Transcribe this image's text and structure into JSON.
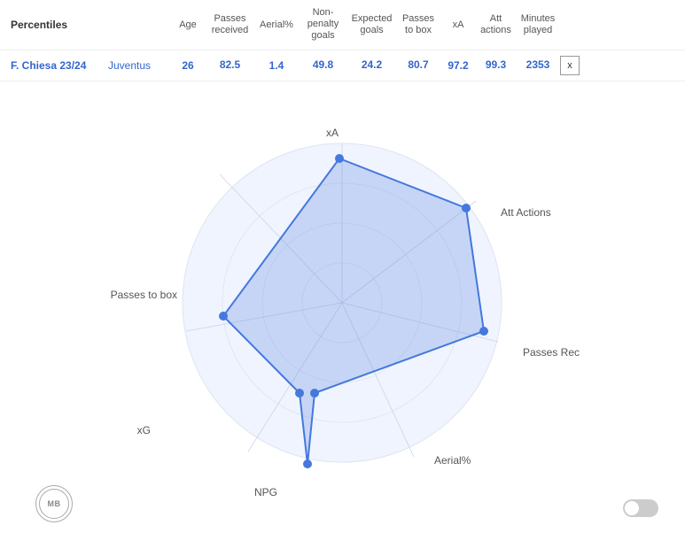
{
  "header": {
    "percentiles_label": "Percentiles",
    "columns": {
      "age": "Age",
      "passes_received": "Passes received",
      "aerial": "Aerial%",
      "npg": "Non-penalty goals",
      "xg": "Expected goals",
      "passes_box": "Passes to box",
      "xa": "xA",
      "att_actions": "Att actions",
      "minutes": "Minutes played"
    }
  },
  "player": {
    "name": "F. Chiesa 23/24",
    "team": "Juventus",
    "age": "26",
    "passes_received": "82.5",
    "aerial": "1.4",
    "npg": "49.8",
    "xg": "24.2",
    "passes_box": "80.7",
    "xa": "97.2",
    "att_actions": "99.3",
    "minutes": "2353",
    "close": "x"
  },
  "radar": {
    "labels": {
      "xa": "xA",
      "att_actions": "Att Actions",
      "passes_rec": "Passes Rec",
      "aerial": "Aerial%",
      "npg": "NPG",
      "xg": "xG",
      "passes_box": "Passes to box"
    }
  },
  "logo": {
    "text": "MB"
  },
  "toggle": {
    "label": "toggle"
  }
}
